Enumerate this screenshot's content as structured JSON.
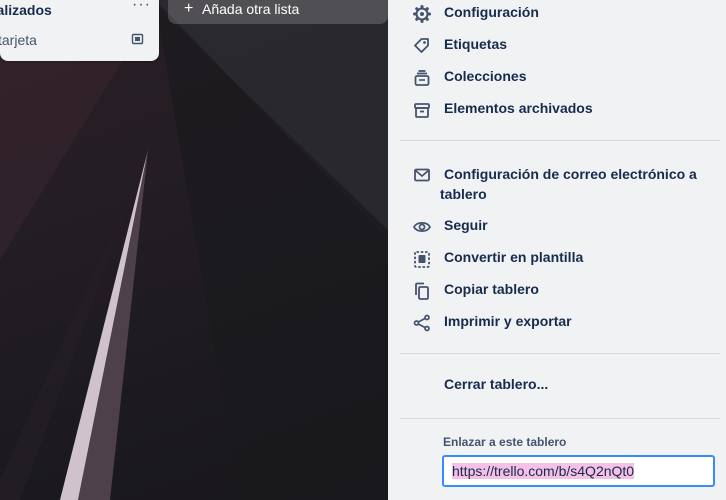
{
  "board_list": {
    "title": "nalizados",
    "menu_icon": "ellipsis-icon",
    "add_card_label": "tarjeta",
    "template_icon": "card-template-icon"
  },
  "add_list": {
    "label": "Añada otra lista",
    "icon": "plus-icon"
  },
  "menu": {
    "items_group1": [
      {
        "label": "Configuración",
        "icon": "gear-icon"
      },
      {
        "label": "Etiquetas",
        "icon": "tag-icon"
      },
      {
        "label": "Colecciones",
        "icon": "collection-icon"
      },
      {
        "label": "Elementos archivados",
        "icon": "archive-icon"
      }
    ],
    "items_group2": [
      {
        "label": "Configuración de correo electrónico a tablero",
        "icon": "email-icon"
      },
      {
        "label": "Seguir",
        "icon": "eye-icon"
      },
      {
        "label": "Convertir en plantilla",
        "icon": "template-icon"
      },
      {
        "label": "Copiar tablero",
        "icon": "copy-icon"
      },
      {
        "label": "Imprimir y exportar",
        "icon": "share-icon"
      }
    ],
    "close_board": "Cerrar tablero...",
    "link_label": "Enlazar a este tablero",
    "link_value": "https://trello.com/b/s4Q2nQt0"
  },
  "colors": {
    "panel_bg": "#f1f2f4",
    "text": "#172b4d",
    "focus": "#388bff",
    "selection": "#f5c1e6"
  }
}
